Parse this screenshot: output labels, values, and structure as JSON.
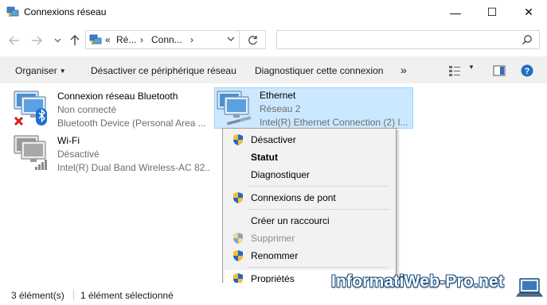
{
  "window": {
    "title": "Connexions réseau",
    "minimize_glyph": "—",
    "maximize_glyph": "☐",
    "close_glyph": "✕"
  },
  "address": {
    "overflow": "«",
    "segments": [
      "Ré...",
      "Conn..."
    ],
    "separator": "›",
    "search_placeholder": ""
  },
  "toolbar": {
    "organiser": "Organiser",
    "disable": "Désactiver ce périphérique réseau",
    "diagnose": "Diagnostiquer cette connexion",
    "more": "»"
  },
  "connections": [
    {
      "name": "Connexion réseau Bluetooth",
      "status": "Non connecté",
      "device": "Bluetooth Device (Personal Area ...",
      "icon": "bluetooth-network-icon",
      "selected": false
    },
    {
      "name": "Ethernet",
      "status": "Réseau 2",
      "device": "Intel(R) Ethernet Connection (2) I...",
      "icon": "ethernet-network-icon",
      "selected": true
    },
    {
      "name": "Wi-Fi",
      "status": "Désactivé",
      "device": "Intel(R) Dual Band Wireless-AC 82...",
      "icon": "wifi-network-icon",
      "selected": false
    }
  ],
  "context_menu": {
    "items": [
      {
        "label": "Désactiver",
        "shield": true,
        "bold": false,
        "disabled": false
      },
      {
        "label": "Statut",
        "shield": false,
        "bold": true,
        "disabled": false
      },
      {
        "label": "Diagnostiquer",
        "shield": false,
        "bold": false,
        "disabled": false
      },
      {
        "label": "Connexions de pont",
        "shield": true,
        "bold": false,
        "disabled": false
      },
      {
        "label": "Créer un raccourci",
        "shield": false,
        "bold": false,
        "disabled": false
      },
      {
        "label": "Supprimer",
        "shield": true,
        "bold": false,
        "disabled": true
      },
      {
        "label": "Renommer",
        "shield": true,
        "bold": false,
        "disabled": false
      },
      {
        "label": "Propriétés",
        "shield": true,
        "bold": false,
        "disabled": false,
        "highlighted": true
      }
    ]
  },
  "statusbar": {
    "count": "3 élément(s)",
    "selection": "1 élément sélectionné"
  },
  "watermark": {
    "text": "InformatiWeb-Pro.net"
  },
  "colors": {
    "selection_bg": "#cce8ff",
    "selection_border": "#99d1ff",
    "toolbar_bg": "#f0f0f0",
    "menu_bg": "#f2f2f2",
    "help_blue": "#1f6fc5"
  }
}
